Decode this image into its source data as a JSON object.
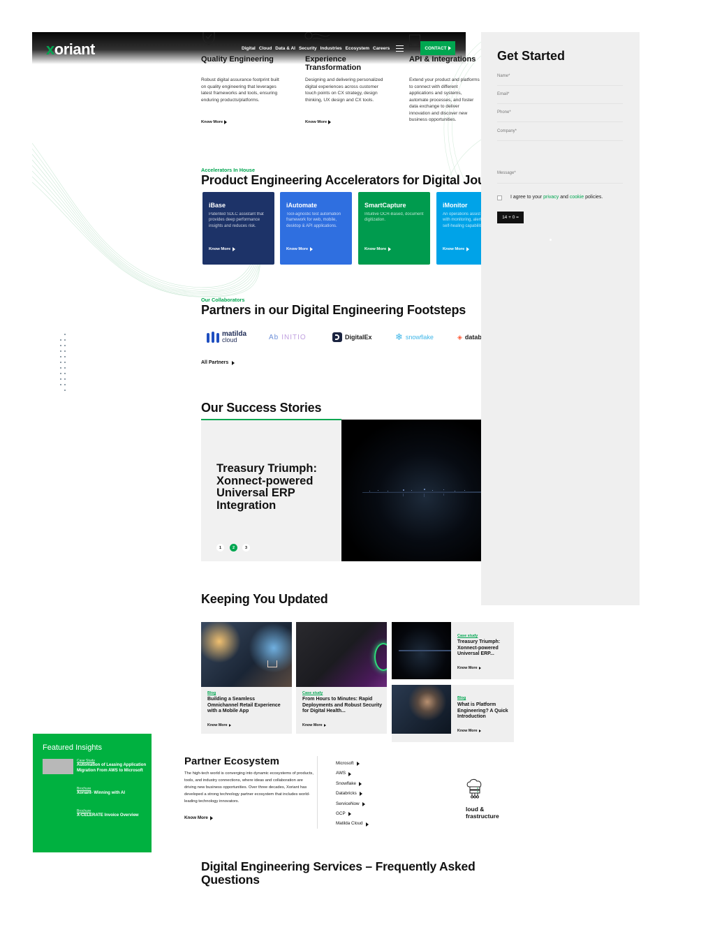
{
  "header": {
    "logo_x": "x",
    "logo_rest": "oriant",
    "nav": [
      "Digital",
      "Cloud",
      "Data & AI",
      "Security",
      "Industries",
      "Ecosystem",
      "Careers"
    ],
    "contact_label": "CONTACT"
  },
  "services": [
    {
      "title": "Quality Engineering",
      "desc": "Robust digital assurance footprint built on quality engineering that leverages latest frameworks and tools, ensuring enduring products/platforms.",
      "link": "Know More"
    },
    {
      "title": "Experience Transformation",
      "desc": "Designing and delivering personalized digital experiences across customer touch points on CX strategy, design thinking, UX design and CX tools.",
      "link": "Know More"
    },
    {
      "title": "API & Integrations",
      "desc": "Extend your product and platforms to connect with different applications and systems, automate processes, and foster data exchange to deliver innovation and discover new business opportunities."
    }
  ],
  "form": {
    "title": "Get Started",
    "fields": [
      "Name*",
      "Email*",
      "Phone*",
      "Company*",
      "Message*"
    ],
    "agree_prefix": "I agree to your",
    "privacy": "privacy",
    "and": "and",
    "cookie": "cookie",
    "agree_suffix": "policies.",
    "captcha": "14 + 0 ="
  },
  "accelerators": {
    "eyebrow": "Accelerators In House",
    "title": "Product Engineering Accelerators for Digital Journeys",
    "cards": [
      {
        "name": "iBase",
        "desc": "Patented SDLC assistant that provides deep performance insights and reduces risk.",
        "link": "Know More",
        "color": "#1d3368"
      },
      {
        "name": "iAutomate",
        "desc": "Tool-agnostic test automation framework for web, mobile, desktop & API applications.",
        "link": "Know More",
        "color": "#2f6fe0"
      },
      {
        "name": "SmartCapture",
        "desc": "Intuitive OCR-Based, document digitization.",
        "link": "Know More",
        "color": "#009b4e"
      },
      {
        "name": "iMonitor",
        "desc": "An operations assist framework with monitoring, alerting, and self-healing capabilities.",
        "link": "Know More",
        "color": "#00a3e8"
      }
    ]
  },
  "partners": {
    "eyebrow": "Our Collaborators",
    "title": "Partners in our Digital Engineering Footsteps",
    "logos": [
      {
        "name": "matilda",
        "sub": "cloud"
      },
      {
        "name": "INITIO",
        "pre": "Ab"
      },
      {
        "name": "DigitalEx"
      },
      {
        "name": "snowflake"
      },
      {
        "name": "databricks"
      }
    ],
    "all_label": "All Partners"
  },
  "success": {
    "title": "Our Success Stories",
    "story_title": "Treasury Triumph: Xonnect-powered Universal ERP Integration",
    "pages": [
      "1",
      "2",
      "3"
    ],
    "active_page": "2"
  },
  "updates": {
    "title": "Keeping You Updated",
    "cards": [
      {
        "tag": "Blog",
        "title": "Building a Seamless Omnichannel Retail Experience with a Mobile App",
        "link": "Know More"
      },
      {
        "tag": "Case study",
        "title": "From Hours to Minutes: Rapid Deployments and Robust Security for Digital Health...",
        "link": "Know More"
      },
      {
        "tag": "Case study",
        "title": "Treasury Triumph: Xonnect-powered Universal ERP...",
        "link": "Know More"
      },
      {
        "tag": "Blog",
        "title": "What is Platform Engineering? A Quick Introduction",
        "link": "Know More"
      }
    ]
  },
  "featured": {
    "title": "Featured Insights",
    "items": [
      {
        "type": "Case Study",
        "title": "Automation of Leasing Application Migration From AWS to Microsoft"
      },
      {
        "type": "Brochure",
        "title": "Xoriant- Winning with AI"
      },
      {
        "type": "Brochure",
        "title": "X-CELERATE Invoice Overview"
      }
    ]
  },
  "ecosystem": {
    "title": "Partner Ecosystem",
    "desc": "The high-tech world is converging into dynamic ecosystems of products, tools, and industry connections, where ideas and collaboration are driving new business opportunities. Over three decades, Xoriant has developed a strong technology partner ecosystem that includes world-leading technology innovators.",
    "link": "Know More",
    "partners": [
      "Microsoft",
      "AWS",
      "Snowflake",
      "Databricks",
      "ServiceNow",
      "GCP",
      "Matilda Cloud"
    ],
    "side_title": "loud & frastructure"
  },
  "faq": {
    "title": "Digital Engineering Services – Frequently Asked Questions"
  },
  "colors": {
    "brand_green": "#00a650",
    "featured_green": "#00b140",
    "form_bg": "#efefef"
  }
}
